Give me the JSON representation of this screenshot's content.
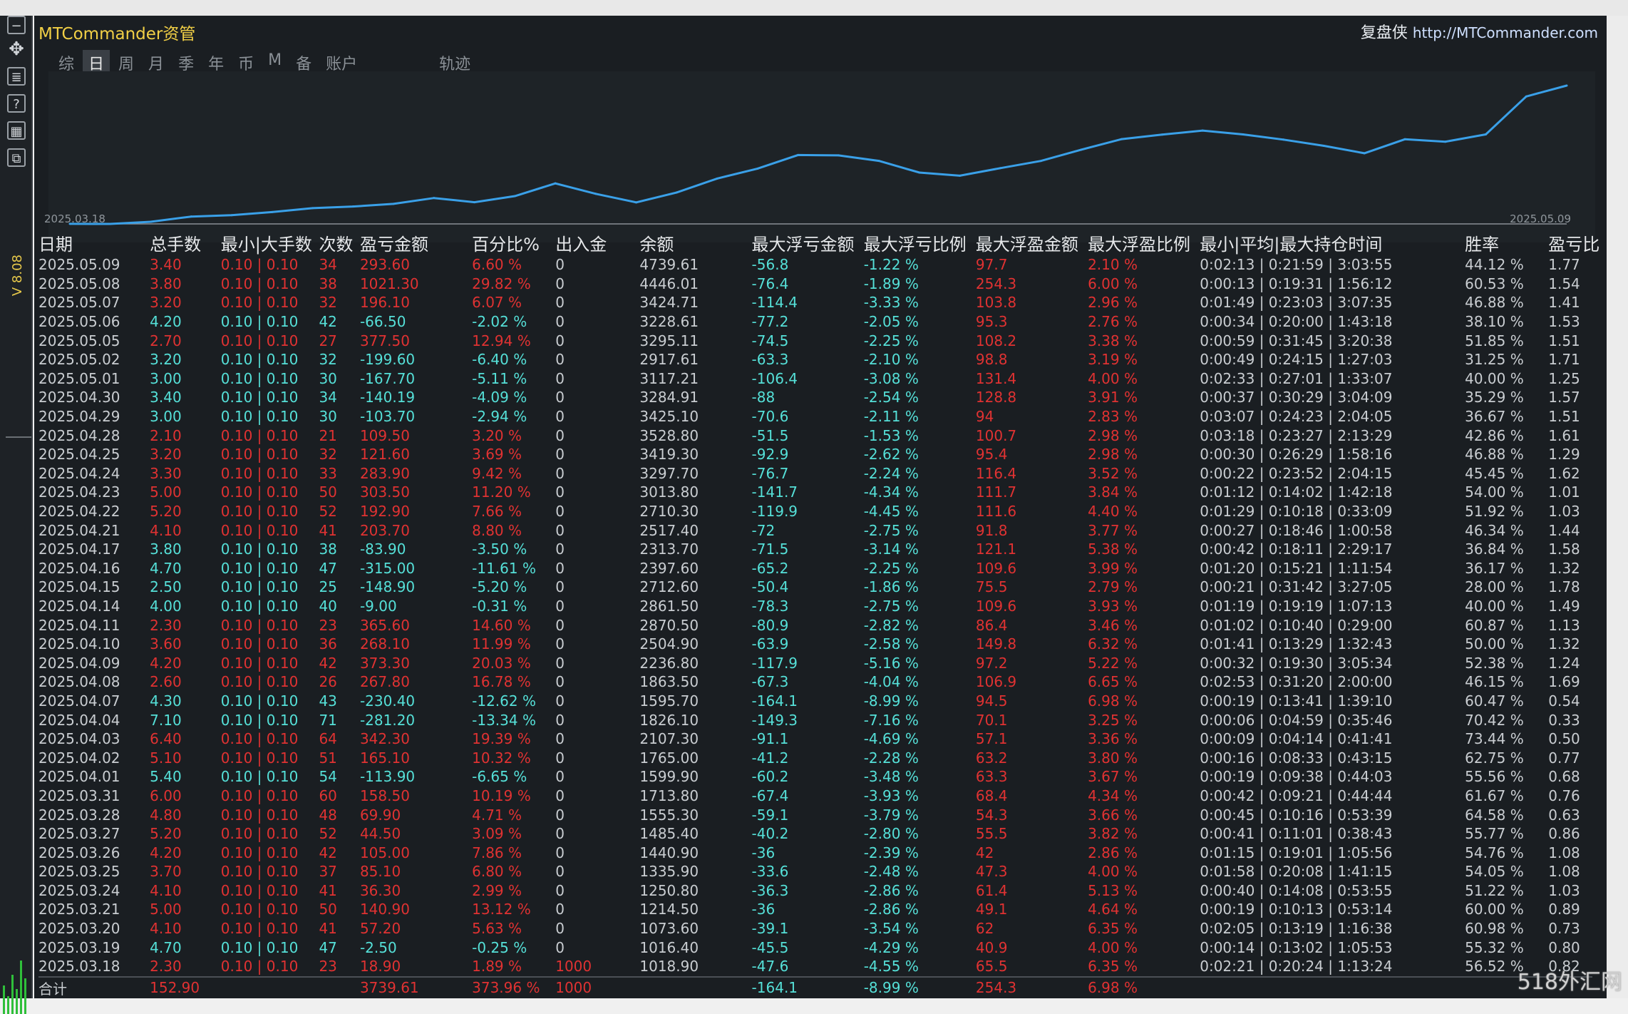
{
  "app": {
    "title": "MTCommander资管",
    "brand": "复盘侠",
    "site": "http://MTCommander.com",
    "side_label": "V 8.08"
  },
  "tabs": [
    {
      "label": "综"
    },
    {
      "label": "日",
      "active": true
    },
    {
      "label": "周"
    },
    {
      "label": "月"
    },
    {
      "label": "季"
    },
    {
      "label": "年"
    },
    {
      "label": "币"
    },
    {
      "label": "M"
    },
    {
      "label": "备"
    },
    {
      "label": "账户"
    },
    {
      "label": "轨迹"
    }
  ],
  "chart_data": {
    "type": "line",
    "x_start": "2025.03.18",
    "x_end": "2025.05.09",
    "x": [
      "2025.03.18",
      "2025.03.19",
      "2025.03.20",
      "2025.03.21",
      "2025.03.24",
      "2025.03.25",
      "2025.03.26",
      "2025.03.27",
      "2025.03.28",
      "2025.03.31",
      "2025.04.01",
      "2025.04.02",
      "2025.04.03",
      "2025.04.04",
      "2025.04.07",
      "2025.04.08",
      "2025.04.09",
      "2025.04.10",
      "2025.04.11",
      "2025.04.14",
      "2025.04.15",
      "2025.04.16",
      "2025.04.17",
      "2025.04.21",
      "2025.04.22",
      "2025.04.23",
      "2025.04.24",
      "2025.04.25",
      "2025.04.28",
      "2025.04.29",
      "2025.04.30",
      "2025.05.01",
      "2025.05.02",
      "2025.05.05",
      "2025.05.06",
      "2025.05.07",
      "2025.05.08",
      "2025.05.09"
    ],
    "values": [
      1018.9,
      1016.4,
      1073.6,
      1214.5,
      1250.8,
      1335.9,
      1440.9,
      1485.4,
      1555.3,
      1713.8,
      1599.9,
      1765.0,
      2107.3,
      1826.1,
      1595.7,
      1863.5,
      2236.8,
      2504.9,
      2870.5,
      2861.5,
      2712.6,
      2397.6,
      2313.7,
      2517.4,
      2710.3,
      3013.8,
      3297.7,
      3419.3,
      3528.8,
      3425.1,
      3284.91,
      3117.21,
      2917.61,
      3295.11,
      3228.61,
      3424.71,
      4446.01,
      4739.61
    ],
    "color": "#3aa0e8"
  },
  "table": {
    "headers": [
      "日期",
      "总手数",
      "最小|大手数",
      "次数",
      "盈亏金额",
      "百分比%",
      "出入金",
      "余额",
      "最大浮亏金额",
      "最大浮亏比例",
      "最大浮盈金额",
      "最大浮盈比例",
      "最小|平均|最大持仓时间",
      "胜率",
      "盈亏比"
    ],
    "rows": [
      {
        "c": "r",
        "v": [
          "2025.05.09",
          "3.40",
          "0.10 | 0.10",
          "34",
          "293.60",
          "6.60 %",
          "0",
          "4739.61",
          "-56.8",
          "-1.22 %",
          "97.7",
          "2.10 %",
          "0:02:13 | 0:21:59 | 3:03:55",
          "44.12 %",
          "1.77"
        ]
      },
      {
        "c": "r",
        "v": [
          "2025.05.08",
          "3.80",
          "0.10 | 0.10",
          "38",
          "1021.30",
          "29.82 %",
          "0",
          "4446.01",
          "-76.4",
          "-1.89 %",
          "254.3",
          "6.00 %",
          "0:00:13 | 0:19:31 | 1:56:12",
          "60.53 %",
          "1.54"
        ]
      },
      {
        "c": "r",
        "v": [
          "2025.05.07",
          "3.20",
          "0.10 | 0.10",
          "32",
          "196.10",
          "6.07 %",
          "0",
          "3424.71",
          "-114.4",
          "-3.33 %",
          "103.8",
          "2.96 %",
          "0:01:49 | 0:23:03 | 3:07:35",
          "46.88 %",
          "1.41"
        ]
      },
      {
        "c": "c",
        "v": [
          "2025.05.06",
          "4.20",
          "0.10 | 0.10",
          "42",
          "-66.50",
          "-2.02 %",
          "0",
          "3228.61",
          "-77.2",
          "-2.05 %",
          "95.3",
          "2.76 %",
          "0:00:34 | 0:20:00 | 1:43:18",
          "38.10 %",
          "1.53"
        ]
      },
      {
        "c": "r",
        "v": [
          "2025.05.05",
          "2.70",
          "0.10 | 0.10",
          "27",
          "377.50",
          "12.94 %",
          "0",
          "3295.11",
          "-74.5",
          "-2.25 %",
          "108.2",
          "3.38 %",
          "0:00:59 | 0:31:45 | 3:20:38",
          "51.85 %",
          "1.51"
        ]
      },
      {
        "c": "c",
        "v": [
          "2025.05.02",
          "3.20",
          "0.10 | 0.10",
          "32",
          "-199.60",
          "-6.40 %",
          "0",
          "2917.61",
          "-63.3",
          "-2.10 %",
          "98.8",
          "3.19 %",
          "0:00:49 | 0:24:15 | 1:27:03",
          "31.25 %",
          "1.71"
        ]
      },
      {
        "c": "c",
        "v": [
          "2025.05.01",
          "3.00",
          "0.10 | 0.10",
          "30",
          "-167.70",
          "-5.11 %",
          "0",
          "3117.21",
          "-106.4",
          "-3.08 %",
          "131.4",
          "4.00 %",
          "0:02:33 | 0:27:01 | 1:33:07",
          "40.00 %",
          "1.25"
        ]
      },
      {
        "c": "c",
        "v": [
          "2025.04.30",
          "3.40",
          "0.10 | 0.10",
          "34",
          "-140.19",
          "-4.09 %",
          "0",
          "3284.91",
          "-88",
          "-2.54 %",
          "128.8",
          "3.91 %",
          "0:00:37 | 0:30:29 | 3:04:09",
          "35.29 %",
          "1.57"
        ]
      },
      {
        "c": "c",
        "v": [
          "2025.04.29",
          "3.00",
          "0.10 | 0.10",
          "30",
          "-103.70",
          "-2.94 %",
          "0",
          "3425.10",
          "-70.6",
          "-2.11 %",
          "94",
          "2.83 %",
          "0:03:07 | 0:24:23 | 2:04:05",
          "36.67 %",
          "1.51"
        ]
      },
      {
        "c": "r",
        "v": [
          "2025.04.28",
          "2.10",
          "0.10 | 0.10",
          "21",
          "109.50",
          "3.20 %",
          "0",
          "3528.80",
          "-51.5",
          "-1.53 %",
          "100.7",
          "2.98 %",
          "0:03:18 | 0:23:27 | 2:13:29",
          "42.86 %",
          "1.61"
        ]
      },
      {
        "c": "r",
        "v": [
          "2025.04.25",
          "3.20",
          "0.10 | 0.10",
          "32",
          "121.60",
          "3.69 %",
          "0",
          "3419.30",
          "-92.9",
          "-2.62 %",
          "95.4",
          "2.98 %",
          "0:00:30 | 0:26:29 | 1:58:16",
          "46.88 %",
          "1.29"
        ]
      },
      {
        "c": "r",
        "v": [
          "2025.04.24",
          "3.30",
          "0.10 | 0.10",
          "33",
          "283.90",
          "9.42 %",
          "0",
          "3297.70",
          "-76.7",
          "-2.24 %",
          "116.4",
          "3.52 %",
          "0:00:22 | 0:23:52 | 2:04:15",
          "45.45 %",
          "1.62"
        ]
      },
      {
        "c": "r",
        "v": [
          "2025.04.23",
          "5.00",
          "0.10 | 0.10",
          "50",
          "303.50",
          "11.20 %",
          "0",
          "3013.80",
          "-141.7",
          "-4.34 %",
          "111.7",
          "3.84 %",
          "0:01:12 | 0:14:02 | 1:42:18",
          "54.00 %",
          "1.01"
        ]
      },
      {
        "c": "r",
        "v": [
          "2025.04.22",
          "5.20",
          "0.10 | 0.10",
          "52",
          "192.90",
          "7.66 %",
          "0",
          "2710.30",
          "-119.9",
          "-4.45 %",
          "111.6",
          "4.40 %",
          "0:01:29 | 0:10:18 | 0:33:09",
          "51.92 %",
          "1.03"
        ]
      },
      {
        "c": "r",
        "v": [
          "2025.04.21",
          "4.10",
          "0.10 | 0.10",
          "41",
          "203.70",
          "8.80 %",
          "0",
          "2517.40",
          "-72",
          "-2.75 %",
          "91.8",
          "3.77 %",
          "0:00:27 | 0:18:46 | 1:00:58",
          "46.34 %",
          "1.44"
        ]
      },
      {
        "c": "c",
        "v": [
          "2025.04.17",
          "3.80",
          "0.10 | 0.10",
          "38",
          "-83.90",
          "-3.50 %",
          "0",
          "2313.70",
          "-71.5",
          "-3.14 %",
          "121.1",
          "5.38 %",
          "0:00:42 | 0:18:11 | 2:29:17",
          "36.84 %",
          "1.58"
        ]
      },
      {
        "c": "c",
        "v": [
          "2025.04.16",
          "4.70",
          "0.10 | 0.10",
          "47",
          "-315.00",
          "-11.61 %",
          "0",
          "2397.60",
          "-65.2",
          "-2.25 %",
          "109.6",
          "3.99 %",
          "0:01:20 | 0:15:21 | 1:11:54",
          "36.17 %",
          "1.32"
        ]
      },
      {
        "c": "c",
        "v": [
          "2025.04.15",
          "2.50",
          "0.10 | 0.10",
          "25",
          "-148.90",
          "-5.20 %",
          "0",
          "2712.60",
          "-50.4",
          "-1.86 %",
          "75.5",
          "2.79 %",
          "0:00:21 | 0:31:42 | 3:27:05",
          "28.00 %",
          "1.78"
        ]
      },
      {
        "c": "c",
        "v": [
          "2025.04.14",
          "4.00",
          "0.10 | 0.10",
          "40",
          "-9.00",
          "-0.31 %",
          "0",
          "2861.50",
          "-78.3",
          "-2.75 %",
          "109.6",
          "3.93 %",
          "0:01:19 | 0:19:19 | 1:07:13",
          "40.00 %",
          "1.49"
        ]
      },
      {
        "c": "r",
        "v": [
          "2025.04.11",
          "2.30",
          "0.10 | 0.10",
          "23",
          "365.60",
          "14.60 %",
          "0",
          "2870.50",
          "-80.9",
          "-2.82 %",
          "86.4",
          "3.46 %",
          "0:01:02 | 0:10:40 | 0:29:00",
          "60.87 %",
          "1.13"
        ]
      },
      {
        "c": "r",
        "v": [
          "2025.04.10",
          "3.60",
          "0.10 | 0.10",
          "36",
          "268.10",
          "11.99 %",
          "0",
          "2504.90",
          "-63.9",
          "-2.58 %",
          "149.8",
          "6.32 %",
          "0:01:41 | 0:13:29 | 1:32:43",
          "50.00 %",
          "1.32"
        ]
      },
      {
        "c": "r",
        "v": [
          "2025.04.09",
          "4.20",
          "0.10 | 0.10",
          "42",
          "373.30",
          "20.03 %",
          "0",
          "2236.80",
          "-117.9",
          "-5.16 %",
          "97.2",
          "5.22 %",
          "0:00:32 | 0:19:30 | 3:05:34",
          "52.38 %",
          "1.24"
        ]
      },
      {
        "c": "r",
        "v": [
          "2025.04.08",
          "2.60",
          "0.10 | 0.10",
          "26",
          "267.80",
          "16.78 %",
          "0",
          "1863.50",
          "-67.3",
          "-4.04 %",
          "106.9",
          "6.65 %",
          "0:02:53 | 0:31:20 | 2:00:00",
          "46.15 %",
          "1.69"
        ]
      },
      {
        "c": "c",
        "v": [
          "2025.04.07",
          "4.30",
          "0.10 | 0.10",
          "43",
          "-230.40",
          "-12.62 %",
          "0",
          "1595.70",
          "-164.1",
          "-8.99 %",
          "94.5",
          "6.98 %",
          "0:00:19 | 0:13:41 | 1:39:10",
          "60.47 %",
          "0.54"
        ]
      },
      {
        "c": "c",
        "v": [
          "2025.04.04",
          "7.10",
          "0.10 | 0.10",
          "71",
          "-281.20",
          "-13.34 %",
          "0",
          "1826.10",
          "-149.3",
          "-7.16 %",
          "70.1",
          "3.25 %",
          "0:00:06 | 0:04:59 | 0:35:46",
          "70.42 %",
          "0.33"
        ]
      },
      {
        "c": "r",
        "v": [
          "2025.04.03",
          "6.40",
          "0.10 | 0.10",
          "64",
          "342.30",
          "19.39 %",
          "0",
          "2107.30",
          "-91.1",
          "-4.69 %",
          "57.1",
          "3.36 %",
          "0:00:09 | 0:04:14 | 0:41:41",
          "73.44 %",
          "0.50"
        ]
      },
      {
        "c": "r",
        "v": [
          "2025.04.02",
          "5.10",
          "0.10 | 0.10",
          "51",
          "165.10",
          "10.32 %",
          "0",
          "1765.00",
          "-41.2",
          "-2.28 %",
          "63.2",
          "3.80 %",
          "0:00:16 | 0:08:33 | 0:43:15",
          "62.75 %",
          "0.77"
        ]
      },
      {
        "c": "c",
        "v": [
          "2025.04.01",
          "5.40",
          "0.10 | 0.10",
          "54",
          "-113.90",
          "-6.65 %",
          "0",
          "1599.90",
          "-60.2",
          "-3.48 %",
          "63.3",
          "3.67 %",
          "0:00:19 | 0:09:38 | 0:44:03",
          "55.56 %",
          "0.68"
        ]
      },
      {
        "c": "r",
        "v": [
          "2025.03.31",
          "6.00",
          "0.10 | 0.10",
          "60",
          "158.50",
          "10.19 %",
          "0",
          "1713.80",
          "-67.4",
          "-3.93 %",
          "68.4",
          "4.34 %",
          "0:00:42 | 0:09:21 | 0:44:44",
          "61.67 %",
          "0.76"
        ]
      },
      {
        "c": "r",
        "v": [
          "2025.03.28",
          "4.80",
          "0.10 | 0.10",
          "48",
          "69.90",
          "4.71 %",
          "0",
          "1555.30",
          "-59.1",
          "-3.79 %",
          "54.3",
          "3.66 %",
          "0:00:45 | 0:10:16 | 0:53:39",
          "64.58 %",
          "0.63"
        ]
      },
      {
        "c": "r",
        "v": [
          "2025.03.27",
          "5.20",
          "0.10 | 0.10",
          "52",
          "44.50",
          "3.09 %",
          "0",
          "1485.40",
          "-40.2",
          "-2.80 %",
          "55.5",
          "3.82 %",
          "0:00:41 | 0:11:01 | 0:38:43",
          "55.77 %",
          "0.86"
        ]
      },
      {
        "c": "r",
        "v": [
          "2025.03.26",
          "4.20",
          "0.10 | 0.10",
          "42",
          "105.00",
          "7.86 %",
          "0",
          "1440.90",
          "-36",
          "-2.39 %",
          "42",
          "2.86 %",
          "0:01:15 | 0:19:01 | 1:05:56",
          "54.76 %",
          "1.08"
        ]
      },
      {
        "c": "r",
        "v": [
          "2025.03.25",
          "3.70",
          "0.10 | 0.10",
          "37",
          "85.10",
          "6.80 %",
          "0",
          "1335.90",
          "-33.6",
          "-2.48 %",
          "47.3",
          "4.00 %",
          "0:01:58 | 0:20:08 | 1:41:15",
          "54.05 %",
          "1.08"
        ]
      },
      {
        "c": "r",
        "v": [
          "2025.03.24",
          "4.10",
          "0.10 | 0.10",
          "41",
          "36.30",
          "2.99 %",
          "0",
          "1250.80",
          "-36.3",
          "-2.86 %",
          "61.4",
          "5.13 %",
          "0:00:40 | 0:14:08 | 0:53:55",
          "51.22 %",
          "1.03"
        ]
      },
      {
        "c": "r",
        "v": [
          "2025.03.21",
          "5.00",
          "0.10 | 0.10",
          "50",
          "140.90",
          "13.12 %",
          "0",
          "1214.50",
          "-36",
          "-2.86 %",
          "49.1",
          "4.64 %",
          "0:00:19 | 0:10:13 | 0:53:14",
          "60.00 %",
          "0.89"
        ]
      },
      {
        "c": "r",
        "v": [
          "2025.03.20",
          "4.10",
          "0.10 | 0.10",
          "41",
          "57.20",
          "5.63 %",
          "0",
          "1073.60",
          "-39.1",
          "-3.54 %",
          "62",
          "6.35 %",
          "0:02:05 | 0:13:19 | 1:16:38",
          "60.98 %",
          "0.73"
        ]
      },
      {
        "c": "c",
        "v": [
          "2025.03.19",
          "4.70",
          "0.10 | 0.10",
          "47",
          "-2.50",
          "-0.25 %",
          "0",
          "1016.40",
          "-45.5",
          "-4.29 %",
          "40.9",
          "4.00 %",
          "0:00:14 | 0:13:02 | 1:05:53",
          "55.32 %",
          "0.80"
        ]
      },
      {
        "c": "r",
        "v": [
          "2025.03.18",
          "2.30",
          "0.10 | 0.10",
          "23",
          "18.90",
          "1.89 %",
          "1000",
          "1018.90",
          "-47.6",
          "-4.55 %",
          "65.5",
          "6.35 %",
          "0:02:21 | 0:20:24 | 1:13:24",
          "56.52 %",
          "0.82"
        ]
      }
    ],
    "total": [
      "合计",
      "152.90",
      "",
      "",
      "3739.61",
      "373.96 %",
      "1000",
      "",
      "-164.1",
      "-8.99 %",
      "254.3",
      "6.98 %",
      "",
      "",
      ""
    ]
  },
  "watermark": "518外汇网"
}
